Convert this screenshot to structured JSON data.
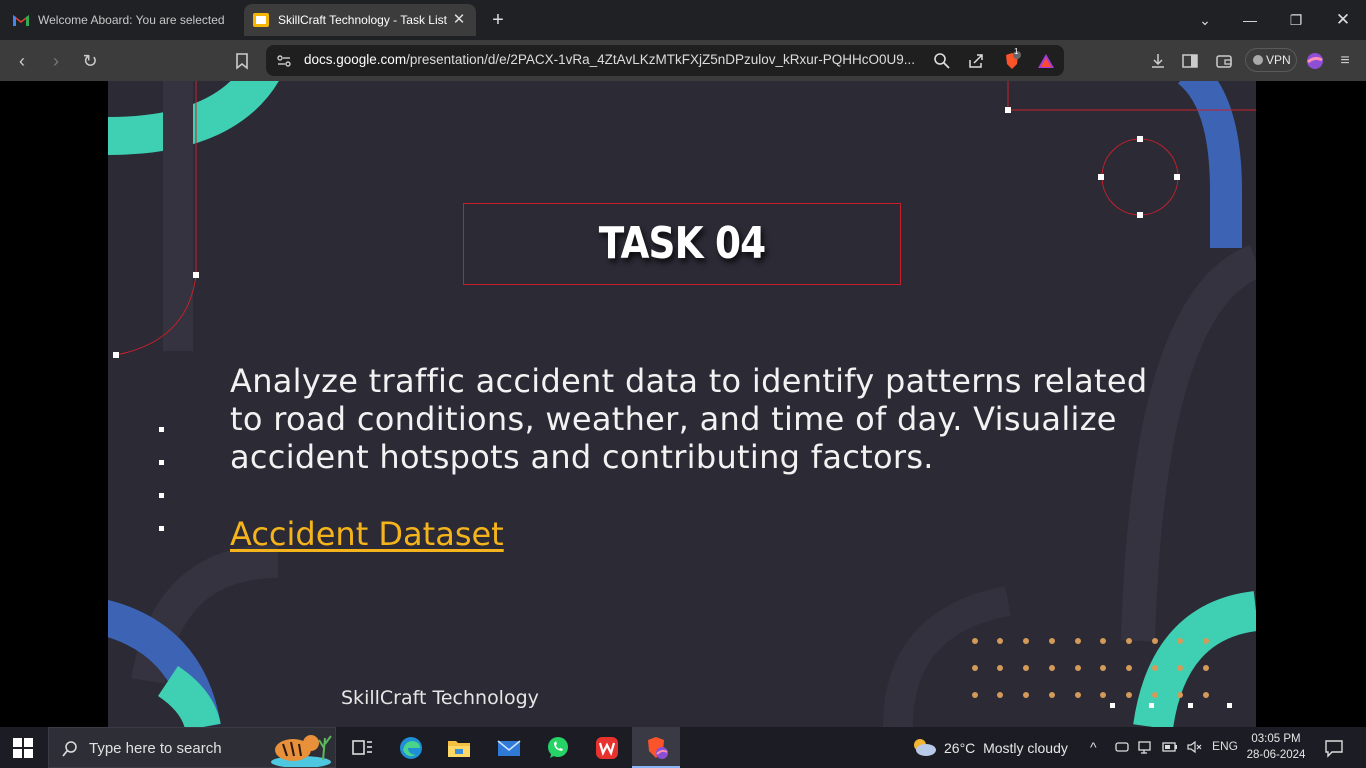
{
  "browser": {
    "tabs": [
      {
        "title": "Welcome Aboard: You are selected f…",
        "state": "inactive"
      },
      {
        "title": "SkillCraft Technology - Task List",
        "state": "active"
      }
    ],
    "url": {
      "host": "docs.google.com",
      "path": "/presentation/d/e/2PACX-1vRa_4ZtAvLKzMTkFXjZ5nDPzulov_kRxur-PQHHcO0U9..."
    },
    "vpn_label": "VPN",
    "shield_badge": "1"
  },
  "slide": {
    "title": "TASK 04",
    "body": "Analyze traffic accident data to identify patterns related to road conditions, weather, and time of day. Visualize accident hotspots and contributing factors.",
    "link_text": "Accident Dataset",
    "footer": "SkillCraft Technology",
    "colors": {
      "background": "#2b2a35",
      "accent_teal": "#3fcfb2",
      "accent_blue": "#3d63b5",
      "accent_red": "#c8202b",
      "link": "#f5b41b",
      "dots": "#d49a5a"
    }
  },
  "taskbar": {
    "search_placeholder": "Type here to search",
    "weather": {
      "temp": "26°C",
      "condition": "Mostly cloudy"
    },
    "language": "ENG",
    "time": "03:05 PM",
    "date": "28-06-2024"
  }
}
